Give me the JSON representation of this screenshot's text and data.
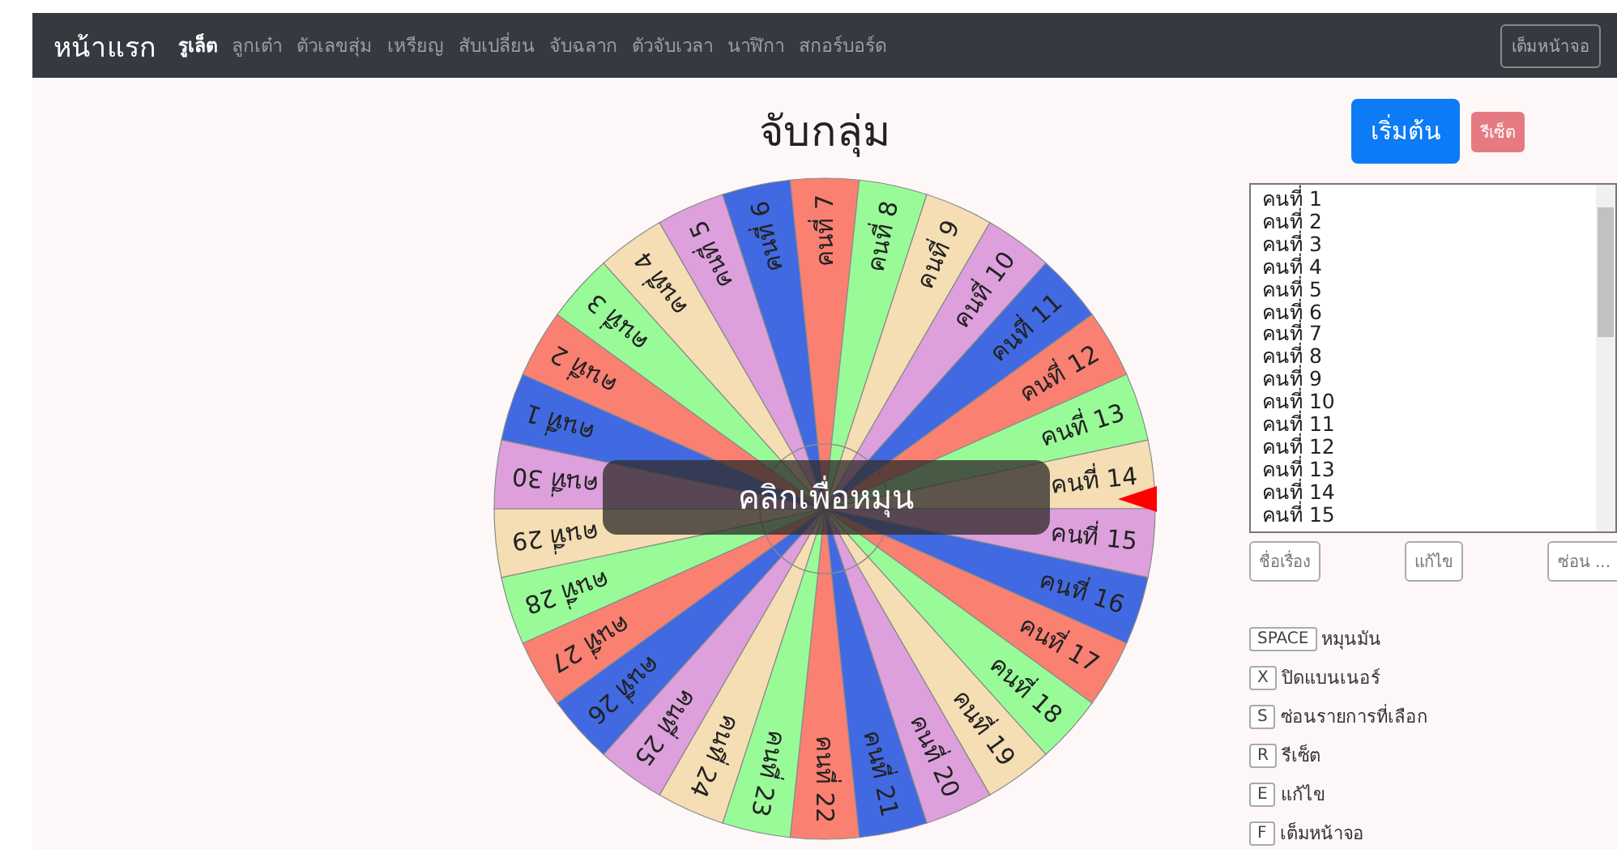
{
  "navbar": {
    "brand": "หน้าแรก",
    "items": [
      {
        "label": "รูเล็ต",
        "selected": true
      },
      {
        "label": "ลูกเต๋า",
        "selected": false
      },
      {
        "label": "ตัวเลขสุ่ม",
        "selected": false
      },
      {
        "label": "เหรียญ",
        "selected": false
      },
      {
        "label": "สับเปลี่ยน",
        "selected": false
      },
      {
        "label": "จับฉลาก",
        "selected": false
      },
      {
        "label": "ตัวจับเวลา",
        "selected": false
      },
      {
        "label": "นาฬิกา",
        "selected": false
      },
      {
        "label": "สกอร์บอร์ด",
        "selected": false
      }
    ],
    "fullscreen_button": "เต็มหน้าจอ"
  },
  "title": "จับกลุ่ม",
  "start_button": "เริ่มต้น",
  "reset_button": "รีเซ็ต",
  "wheel": {
    "spin_label": "คลิกเพื่อหมุน",
    "segments": [
      {
        "label": "คนที่ 1",
        "color": "#4169e1"
      },
      {
        "label": "คนที่ 2",
        "color": "#fa8072"
      },
      {
        "label": "คนที่ 3",
        "color": "#98fb98"
      },
      {
        "label": "คนที่ 4",
        "color": "#f5deb3"
      },
      {
        "label": "คนที่ 5",
        "color": "#dda0dd"
      },
      {
        "label": "คนที่ 6",
        "color": "#4169e1"
      },
      {
        "label": "คนที่ 7",
        "color": "#fa8072"
      },
      {
        "label": "คนที่ 8",
        "color": "#98fb98"
      },
      {
        "label": "คนที่ 9",
        "color": "#f5deb3"
      },
      {
        "label": "คนที่ 10",
        "color": "#dda0dd"
      },
      {
        "label": "คนที่ 11",
        "color": "#4169e1"
      },
      {
        "label": "คนที่ 12",
        "color": "#fa8072"
      },
      {
        "label": "คนที่ 13",
        "color": "#98fb98"
      },
      {
        "label": "คนที่ 14",
        "color": "#f5deb3"
      },
      {
        "label": "คนที่ 15",
        "color": "#dda0dd"
      },
      {
        "label": "คนที่ 16",
        "color": "#4169e1"
      },
      {
        "label": "คนที่ 17",
        "color": "#fa8072"
      },
      {
        "label": "คนที่ 18",
        "color": "#98fb98"
      },
      {
        "label": "คนที่ 19",
        "color": "#f5deb3"
      },
      {
        "label": "คนที่ 20",
        "color": "#dda0dd"
      },
      {
        "label": "คนที่ 21",
        "color": "#4169e1"
      },
      {
        "label": "คนที่ 22",
        "color": "#fa8072"
      },
      {
        "label": "คนที่ 23",
        "color": "#98fb98"
      },
      {
        "label": "คนที่ 24",
        "color": "#f5deb3"
      },
      {
        "label": "คนที่ 25",
        "color": "#dda0dd"
      },
      {
        "label": "คนที่ 26",
        "color": "#4169e1"
      },
      {
        "label": "คนที่ 27",
        "color": "#fa8072"
      },
      {
        "label": "คนที่ 28",
        "color": "#98fb98"
      },
      {
        "label": "คนที่ 29",
        "color": "#f5deb3"
      },
      {
        "label": "คนที่ 30",
        "color": "#dda0dd"
      }
    ]
  },
  "entries": [
    "คนที่ 1",
    "คนที่ 2",
    "คนที่ 3",
    "คนที่ 4",
    "คนที่ 5",
    "คนที่ 6",
    "คนที่ 7",
    "คนที่ 8",
    "คนที่ 9",
    "คนที่ 10",
    "คนที่ 11",
    "คนที่ 12",
    "คนที่ 13",
    "คนที่ 14",
    "คนที่ 15"
  ],
  "list_buttons": [
    "ชื่อเรื่อง",
    "แก้ไข",
    "ซ่อน ..."
  ],
  "shortcuts": [
    {
      "key": "SPACE",
      "label": "หมุนมัน"
    },
    {
      "key": "X",
      "label": "ปิดแบนเนอร์"
    },
    {
      "key": "S",
      "label": "ซ่อนรายการที่เลือก"
    },
    {
      "key": "R",
      "label": "รีเซ็ต"
    },
    {
      "key": "E",
      "label": "แก้ไข"
    },
    {
      "key": "F",
      "label": "เต็มหน้าจอ"
    }
  ]
}
